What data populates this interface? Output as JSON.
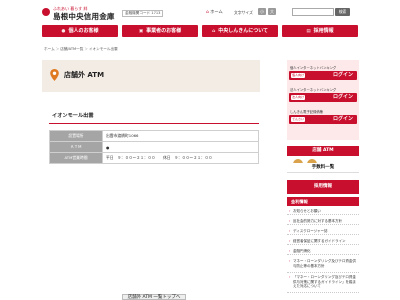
{
  "header": {
    "logo_tagline": "ふれあい 暮らす 絆",
    "logo_name": "島根中央信用金庫",
    "bank_code": "金融機関コード 1713",
    "home_icon": "home-icon",
    "home_label": "ホーム",
    "text_size_label": "文字サイズ",
    "size_small": "小",
    "size_large": "大",
    "search_placeholder": "",
    "search_button": "検索"
  },
  "nav": {
    "items": [
      {
        "label": "個人のお客様",
        "icon": "person-icon"
      },
      {
        "label": "事業者のお客様",
        "icon": "building-icon"
      },
      {
        "label": "中央しんきんについて",
        "icon": "home-icon"
      },
      {
        "label": "採用情報",
        "icon": "document-icon"
      }
    ]
  },
  "breadcrumb": [
    "ホーム",
    "店舗/ATM一覧",
    "イオンモール出雲"
  ],
  "page": {
    "title": "店舗外 ATM",
    "pin_icon": "map-pin-icon",
    "accent": "#c8102e"
  },
  "location": {
    "name": "イオンモール出雲",
    "rows": [
      {
        "label": "設置場所",
        "value": "出雲市渡橋町1066"
      },
      {
        "label": "ＡＴＭ",
        "value": "●"
      },
      {
        "label": "ATM営業時間",
        "value": "平日　９：００～２１：００　　休日　９：００～２１：００"
      }
    ],
    "list_button": "店舗外 ATM 一覧トップへ"
  },
  "sidebar": {
    "login": [
      {
        "caption": "個人インターネットバンキング",
        "chip": "個人向け",
        "label": "ログイン"
      },
      {
        "caption": "法人インターネットバンキング",
        "chip": "法人向け",
        "label": "ログイン"
      },
      {
        "caption": "しんきん電子記録債権",
        "chip": "でんさい",
        "label": "ログイン"
      }
    ],
    "menus": [
      {
        "label": "店舗 ATM"
      },
      {
        "label": "手数料一覧"
      },
      {
        "label": "採用情報"
      }
    ],
    "info_heading": "金利情報",
    "info_items": [
      "お知らせとお願い",
      "反社会的勢力に対する基本方針",
      "ディスクロージャー誌",
      "経営者保証に関するガイドライン",
      "金融円滑化",
      "マネー・ローンダリング及びテロ資金供与防止等の基本方針",
      "「マネー・ローンダリング及びテロ資金供与対策に関するガイドライン」を踏まえた対応について"
    ]
  }
}
